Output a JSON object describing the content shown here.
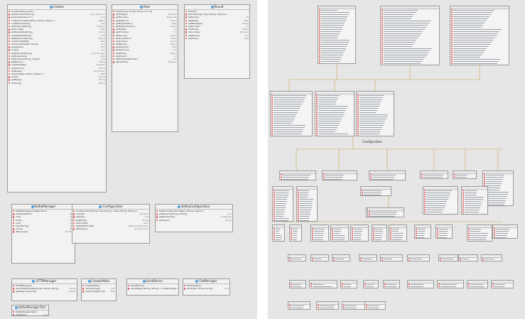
{
  "left": {
    "classes": [
      {
        "id": "creator",
        "title": "Creator",
        "rows": [
          {
            "text": "Creator(String, Rule)",
            "type": ""
          },
          {
            "text": "getGenerated(String)",
            "type": "List<Runner>"
          },
          {
            "text": "generate(Class<?>)",
            "type": "void"
          },
          {
            "text": "createFromObject(Map<String, Object>)",
            "type": "Object"
          },
          {
            "text": "createDoc(String)",
            "type": "void"
          },
          {
            "text": "getSchema(String)",
            "type": "Schema"
          },
          {
            "text": "getConfig()",
            "type": "Map"
          },
          {
            "text": "getTemplate(String)",
            "type": "String"
          },
          {
            "text": "updateRule(String)",
            "type": "void"
          },
          {
            "text": "getResolved(String)",
            "type": "String"
          },
          {
            "text": "readConfig(Path)",
            "type": "Map"
          },
          {
            "text": "writeOutput(Path, String)",
            "type": "void"
          },
          {
            "text": "apply(Rule)",
            "type": "Rule"
          },
          {
            "text": "close()",
            "type": "void"
          },
          {
            "text": "getDefaults(String)",
            "type": "List<String>"
          },
          {
            "text": "getProperties()",
            "type": "Map"
          },
          {
            "text": "setProperty(String, Object)",
            "type": "void"
          },
          {
            "text": "getName()",
            "type": "String"
          },
          {
            "text": "validate(Map)",
            "type": "Boolean"
          },
          {
            "text": "getVersion()",
            "type": "String"
          },
          {
            "text": "getRules()",
            "type": "List<Rule>"
          },
          {
            "text": "resolve(Map<String, Object>)",
            "type": "Map"
          },
          {
            "text": "build()",
            "type": "Result"
          },
          {
            "text": "getType()",
            "type": "String"
          },
          {
            "text": "toString()",
            "type": "String"
          }
        ]
      },
      {
        "id": "rule",
        "title": "Rule",
        "rows": [
          {
            "text": "Rule(String, String, String, int, int)",
            "type": ""
          },
          {
            "text": "getTarget()",
            "type": "Request"
          },
          {
            "text": "getSource()",
            "type": "Response"
          },
          {
            "text": "getPattern()",
            "type": "String"
          },
          {
            "text": "getExpression()",
            "type": "Map"
          },
          {
            "text": "getReplacement()",
            "type": "String"
          },
          {
            "text": "getFlags()",
            "type": "int"
          },
          {
            "text": "getPriority()",
            "type": "int"
          },
          {
            "text": "getGroup()",
            "type": "String"
          },
          {
            "text": "getCondition()",
            "type": "String"
          },
          {
            "text": "getScope()",
            "type": "String"
          },
          {
            "text": "getName()",
            "type": "String"
          },
          {
            "text": "getParams()",
            "type": "Map"
          },
          {
            "text": "getOptions()",
            "type": "List"
          },
          {
            "text": "getValue()",
            "type": "Object"
          },
          {
            "text": "getOrder()",
            "type": "int"
          },
          {
            "text": "setEnabled(Boolean)",
            "type": "void"
          },
          {
            "text": "isEnabled()",
            "type": "Boolean"
          }
        ]
      },
      {
        "id": "result",
        "title": "Result",
        "rows": [
          {
            "text": "Result()",
            "type": ""
          },
          {
            "text": "Result(String, Map<String, Object>)",
            "type": ""
          },
          {
            "text": "getCode()",
            "type": "int"
          },
          {
            "text": "getData()",
            "type": "Map"
          },
          {
            "text": "getMessage()",
            "type": "String"
          },
          {
            "text": "getCount()",
            "type": "int"
          },
          {
            "text": "toString()",
            "type": "String"
          },
          {
            "text": "isSuccess()",
            "type": "Boolean"
          },
          {
            "text": "getErrors()",
            "type": "List"
          },
          {
            "text": "getTime()",
            "type": "long"
          }
        ]
      },
      {
        "id": "kafka-manager",
        "title": "KafkaManager",
        "rows": [
          {
            "text": "KafkaManager(Configuration)",
            "type": ""
          },
          {
            "text": "publish(Result)",
            "type": "void"
          },
          {
            "text": "init()",
            "type": "void"
          },
          {
            "text": "flush()",
            "type": "void"
          },
          {
            "text": "poll()",
            "type": "List"
          },
          {
            "text": "send(String)",
            "type": "void"
          },
          {
            "text": "close()",
            "type": "void"
          },
          {
            "text": "isRunning()",
            "type": "Boolean"
          }
        ]
      },
      {
        "id": "configuration",
        "title": "Configuration",
        "rows": [
          {
            "text": "Configuration(String, List<String>, Map<String, String>)",
            "type": ""
          },
          {
            "text": "isValid()",
            "type": "Boolean"
          },
          {
            "text": "getList()",
            "type": "List"
          },
          {
            "text": "getMode()",
            "type": "String"
          },
          {
            "text": "getConfig()",
            "type": "Rule"
          },
          {
            "text": "getKafkaConfig()",
            "type": "KafkaConfiguration"
          },
          {
            "text": "getTopics()",
            "type": "List<String>"
          }
        ]
      },
      {
        "id": "kafka-configuration",
        "title": "KafkaConfiguration",
        "rows": [
          {
            "text": "KafkaConfiguration(Map<String, Object>)",
            "type": ""
          },
          {
            "text": "setProperty(String, String)",
            "type": "void"
          },
          {
            "text": "getProperties()",
            "type": "Properties"
          },
          {
            "text": "getTopic()",
            "type": "String"
          }
        ]
      },
      {
        "id": "http-manager",
        "title": "HTTPManager",
        "rows": [
          {
            "text": "HTTPManager()",
            "type": ""
          },
          {
            "text": "executeRequest(Request, String, String)",
            "type": "String"
          },
          {
            "text": "getResponseCode()",
            "type": "Integer"
          }
        ]
      },
      {
        "id": "creator-main",
        "title": "CreatorMain",
        "rows": [
          {
            "text": "CreatorMain()",
            "type": ""
          },
          {
            "text": "main(String[])",
            "type": "void"
          },
          {
            "text": "readConfig(String)",
            "type": "Map"
          }
        ]
      },
      {
        "id": "send-parser",
        "title": "SendParser",
        "rows": [
          {
            "text": "SendParser()",
            "type": ""
          },
          {
            "text": "parse(Map<String, String>, Configuration)",
            "type": "void"
          }
        ]
      },
      {
        "id": "file-manager",
        "title": "FileManager",
        "rows": [
          {
            "text": "FileManager()",
            "type": ""
          },
          {
            "text": "write(File, String, String)",
            "type": "void"
          }
        ]
      },
      {
        "id": "kafka-manager-test",
        "title": "KafkaManagerTest",
        "rows": [
          {
            "text": "KafkaManagerTest()",
            "type": ""
          },
          {
            "text": "testSend()",
            "type": "void"
          }
        ]
      }
    ]
  },
  "right": {
    "title": "Configuration",
    "colors": {
      "member": "#d84a4a",
      "class": "#3a8fd1",
      "link": "#c8a24a"
    }
  }
}
